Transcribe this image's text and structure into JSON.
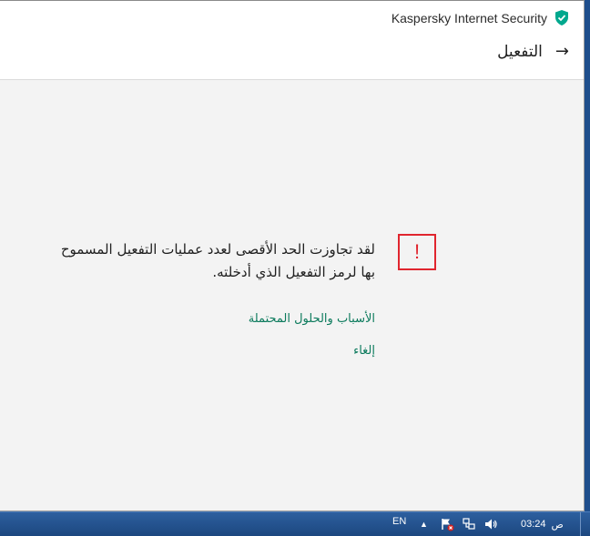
{
  "window": {
    "app_title": "Kaspersky Internet Security",
    "header_title": "التفعيل",
    "back_arrow": "→"
  },
  "error": {
    "icon_glyph": "!",
    "message_line1": "لقد تجاوزت الحد الأقصى لعدد عمليات التفعيل المسموح",
    "message_line2": "بها لرمز التفعيل الذي أدخلته.",
    "link_reasons": "الأسباب والحلول المحتملة",
    "link_cancel": "إلغاء"
  },
  "taskbar": {
    "language": "EN",
    "tray_arrow": "▲",
    "clock_time": "03:24",
    "clock_ampm": "ص"
  },
  "colors": {
    "accent_green": "#0b7a5c",
    "error_red": "#e0252e",
    "shield_green": "#00a88e"
  }
}
